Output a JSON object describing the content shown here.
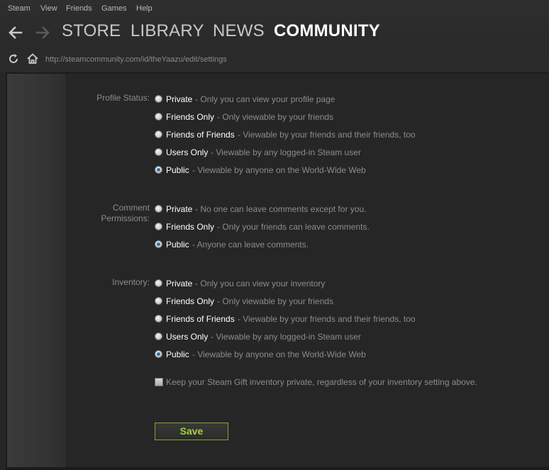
{
  "menu": [
    "Steam",
    "View",
    "Friends",
    "Games",
    "Help"
  ],
  "nav": {
    "back_icon": "arrow-left-icon",
    "forward_icon": "arrow-right-icon",
    "tabs": [
      "STORE",
      "LIBRARY",
      "NEWS",
      "COMMUNITY"
    ],
    "active_tab": "COMMUNITY"
  },
  "urlbar": {
    "refresh_icon": "refresh-icon",
    "home_icon": "home-icon",
    "url": "http://steamcommunity.com/id/theYaazu/edit/settings"
  },
  "profile_status": {
    "label": "Profile Status:",
    "options": [
      {
        "name": "Private",
        "desc": "- Only you can view your profile page",
        "selected": false
      },
      {
        "name": "Friends Only",
        "desc": "- Only viewable by your friends",
        "selected": false
      },
      {
        "name": "Friends of Friends",
        "desc": "- Viewable by your friends and their friends, too",
        "selected": false
      },
      {
        "name": "Users Only",
        "desc": "- Viewable by any logged-in Steam user",
        "selected": false
      },
      {
        "name": "Public",
        "desc": "- Viewable by anyone on the World-Wide Web",
        "selected": true
      }
    ]
  },
  "comment_permissions": {
    "label_line1": "Comment",
    "label_line2": "Permissions:",
    "options": [
      {
        "name": "Private",
        "desc": "- No one can leave comments except for you.",
        "selected": false
      },
      {
        "name": "Friends Only",
        "desc": "- Only your friends can leave comments.",
        "selected": false
      },
      {
        "name": "Public",
        "desc": "- Anyone can leave comments.",
        "selected": true
      }
    ]
  },
  "inventory": {
    "label": "Inventory:",
    "options": [
      {
        "name": "Private",
        "desc": "- Only you can view your inventory",
        "selected": false
      },
      {
        "name": "Friends Only",
        "desc": "- Only viewable by your friends",
        "selected": false
      },
      {
        "name": "Friends of Friends",
        "desc": "- Viewable by your friends and their friends, too",
        "selected": false
      },
      {
        "name": "Users Only",
        "desc": "- Viewable by any logged-in Steam user",
        "selected": false
      },
      {
        "name": "Public",
        "desc": "- Viewable by anyone on the World-Wide Web",
        "selected": true
      }
    ]
  },
  "gift_checkbox": {
    "label": "Keep your Steam Gift inventory private, regardless of your inventory setting above.",
    "checked": false
  },
  "save_label": "Save",
  "colors": {
    "accent_green": "#a5d23c",
    "radio_selected": "#2f6fb3"
  }
}
